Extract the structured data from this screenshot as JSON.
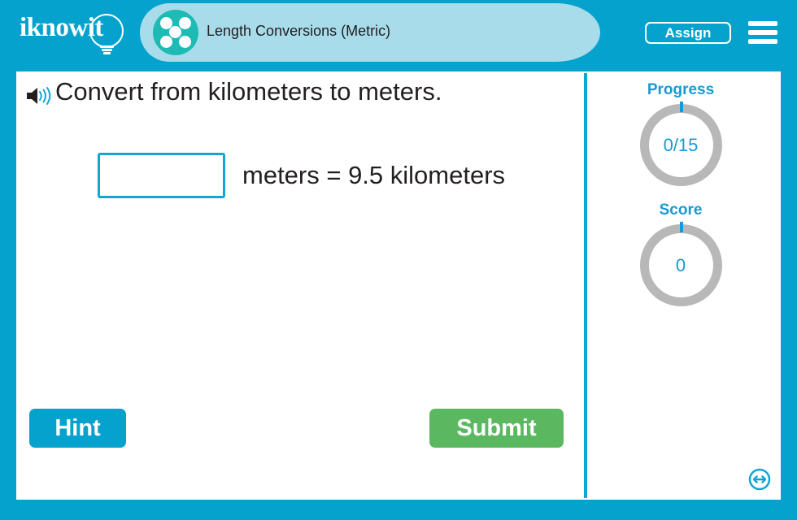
{
  "header": {
    "logo_text": "iknowit",
    "logo_icon": "lightbulb-icon",
    "lesson_icon": "five-dots-icon",
    "title": "Length Conversions (Metric)",
    "assign_label": "Assign",
    "menu_icon": "hamburger-menu-icon",
    "background_color": "#06a2ce",
    "tab_color": "#a8dcea",
    "lesson_icon_color": "#1dbbb4"
  },
  "question": {
    "audio_icon": "speaker-icon",
    "prompt": "Convert from kilometers to meters.",
    "answer_value": "",
    "answer_placeholder": "",
    "equation_text": "meters = 9.5 kilometers"
  },
  "sidebar": {
    "progress": {
      "label": "Progress",
      "value": "0/15"
    },
    "score": {
      "label": "Score",
      "value": "0"
    },
    "accent_color": "#159bd3",
    "ring_color": "#b8b8b8"
  },
  "footer": {
    "hint_label": "Hint",
    "hint_color": "#06a2ce",
    "submit_label": "Submit",
    "submit_color": "#5cb860",
    "resize_icon": "resize-horizontal-icon"
  }
}
